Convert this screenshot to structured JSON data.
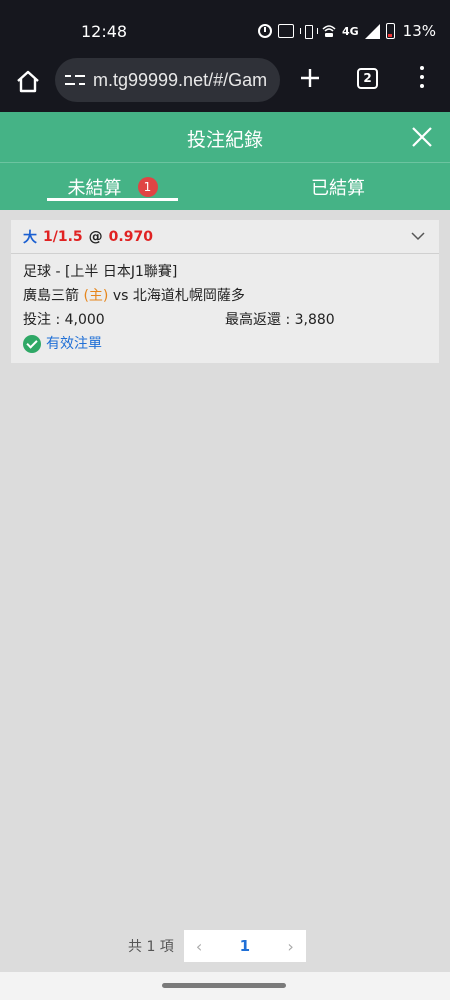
{
  "status_bar": {
    "time": "12:48",
    "network": "4G",
    "battery": "13%",
    "icons": [
      "alarm-icon",
      "auto-box-icon",
      "vibrate-icon",
      "wifi-calling-icon",
      "signal-icon",
      "battery-icon"
    ]
  },
  "browser": {
    "url": "m.tg99999.net/#/Gam",
    "tab_count": "2",
    "icons": [
      "home-icon",
      "site-settings-icon",
      "plus-icon",
      "tabs-icon",
      "more-vert-icon"
    ]
  },
  "header": {
    "title": "投注紀錄",
    "close_icon": "close-icon"
  },
  "tabs": {
    "unsettled": {
      "label": "未結算",
      "badge": "1"
    },
    "settled": {
      "label": "已結算"
    }
  },
  "bet": {
    "type": "大",
    "handicap": "1/1.5",
    "at": "@",
    "odds": "0.970",
    "league_line": "足球 - [上半 日本J1聯賽]",
    "home_team": "廣島三箭",
    "home_tag": "(主)",
    "vs": "vs",
    "away_team": "北海道札幌岡薩多",
    "stake_label": "投注 : 4,000",
    "max_return_label": "最高返還 : 3,880",
    "status": "有效注單"
  },
  "pagination": {
    "total": "共 1 項",
    "prev": "‹",
    "page": "1",
    "next": "›"
  },
  "colors": {
    "status_bar_bg": "#16171e",
    "header_green": "#45b386",
    "badge_red": "#e04444",
    "odds_red": "#e02222",
    "type_blue": "#1a5fd1",
    "home_orange": "#e6861d",
    "valid_green": "#2fa866",
    "page_bg": "#dcdcdc"
  }
}
